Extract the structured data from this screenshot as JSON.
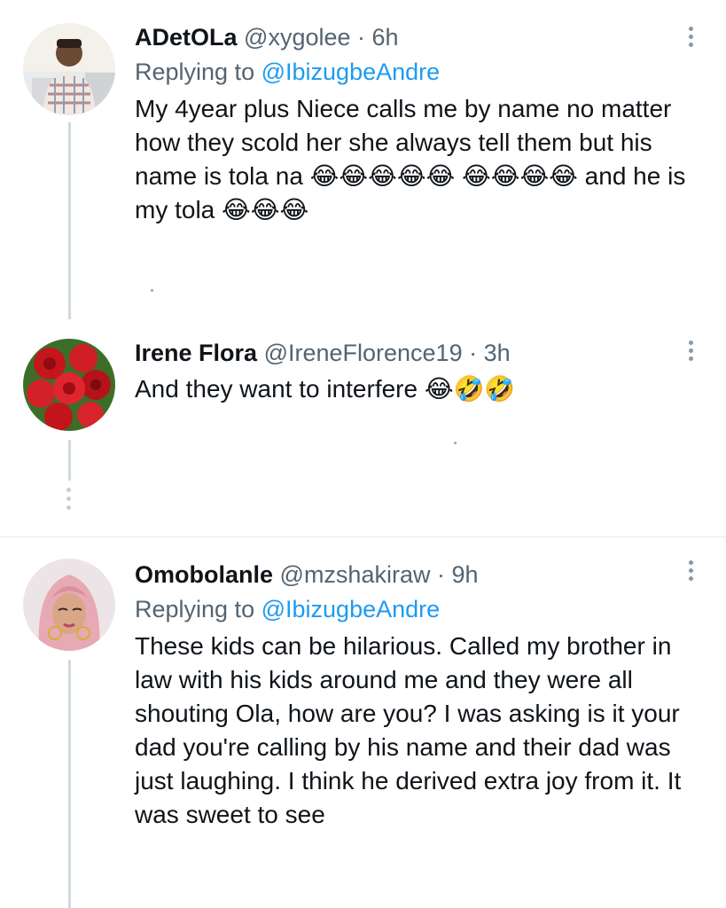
{
  "tweets": [
    {
      "display_name": "ADetOLa",
      "handle": "@xygolee",
      "time": "· 6h",
      "replying_prefix": "Replying to",
      "replying_mention": "@IbizugbeAndre",
      "text": "My 4year plus Niece calls me by name no matter how they scold her she always tell them but his name is tola na 😂😂😂😂😂 😂😂😂😂 and he is my tola 😂😂😂"
    },
    {
      "display_name": "Irene Flora",
      "handle": "@IreneFlorence19",
      "time": "· 3h",
      "text": "And they want to interfere 😂🤣🤣"
    },
    {
      "display_name": "Omobolanle",
      "handle": "@mzshakiraw",
      "time": "· 9h",
      "replying_prefix": "Replying to",
      "replying_mention": "@IbizugbeAndre",
      "text": "These kids can be hilarious. Called my brother in law with his kids around me and they were all shouting Ola, how are you? I was asking is it your dad you're calling by his name and their dad was just laughing. I think he derived extra joy from it. It was sweet to see"
    }
  ],
  "icons": {
    "more": "more-vertical-icon",
    "thread_more": "thread-more-dots-icon"
  },
  "colors": {
    "link": "#1d9bf0",
    "secondary_text": "#536471",
    "thread_line": "#cfd9de"
  }
}
